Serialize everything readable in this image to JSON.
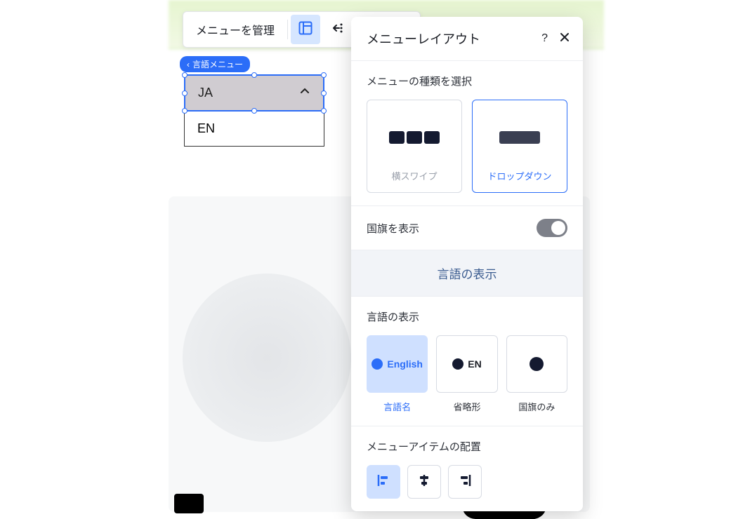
{
  "toolbar": {
    "manage_menu": "メニューを管理"
  },
  "badge": {
    "label": "言語メニュー"
  },
  "dropdown": {
    "selected": "JA",
    "items": [
      "EN"
    ]
  },
  "panel": {
    "title": "メニューレイアウト",
    "menu_type_title": "メニューの種類を選択",
    "type_horizontal": "横スワイプ",
    "type_dropdown": "ドロップダウン",
    "show_flag_label": "国旗を表示",
    "accordion_title": "言語の表示",
    "display_title": "言語の表示",
    "display_english_full": "English",
    "display_english_short": "EN",
    "display_label_full": "言語名",
    "display_label_short": "省略形",
    "display_label_flag": "国旗のみ",
    "align_title": "メニューアイテムの配置"
  }
}
